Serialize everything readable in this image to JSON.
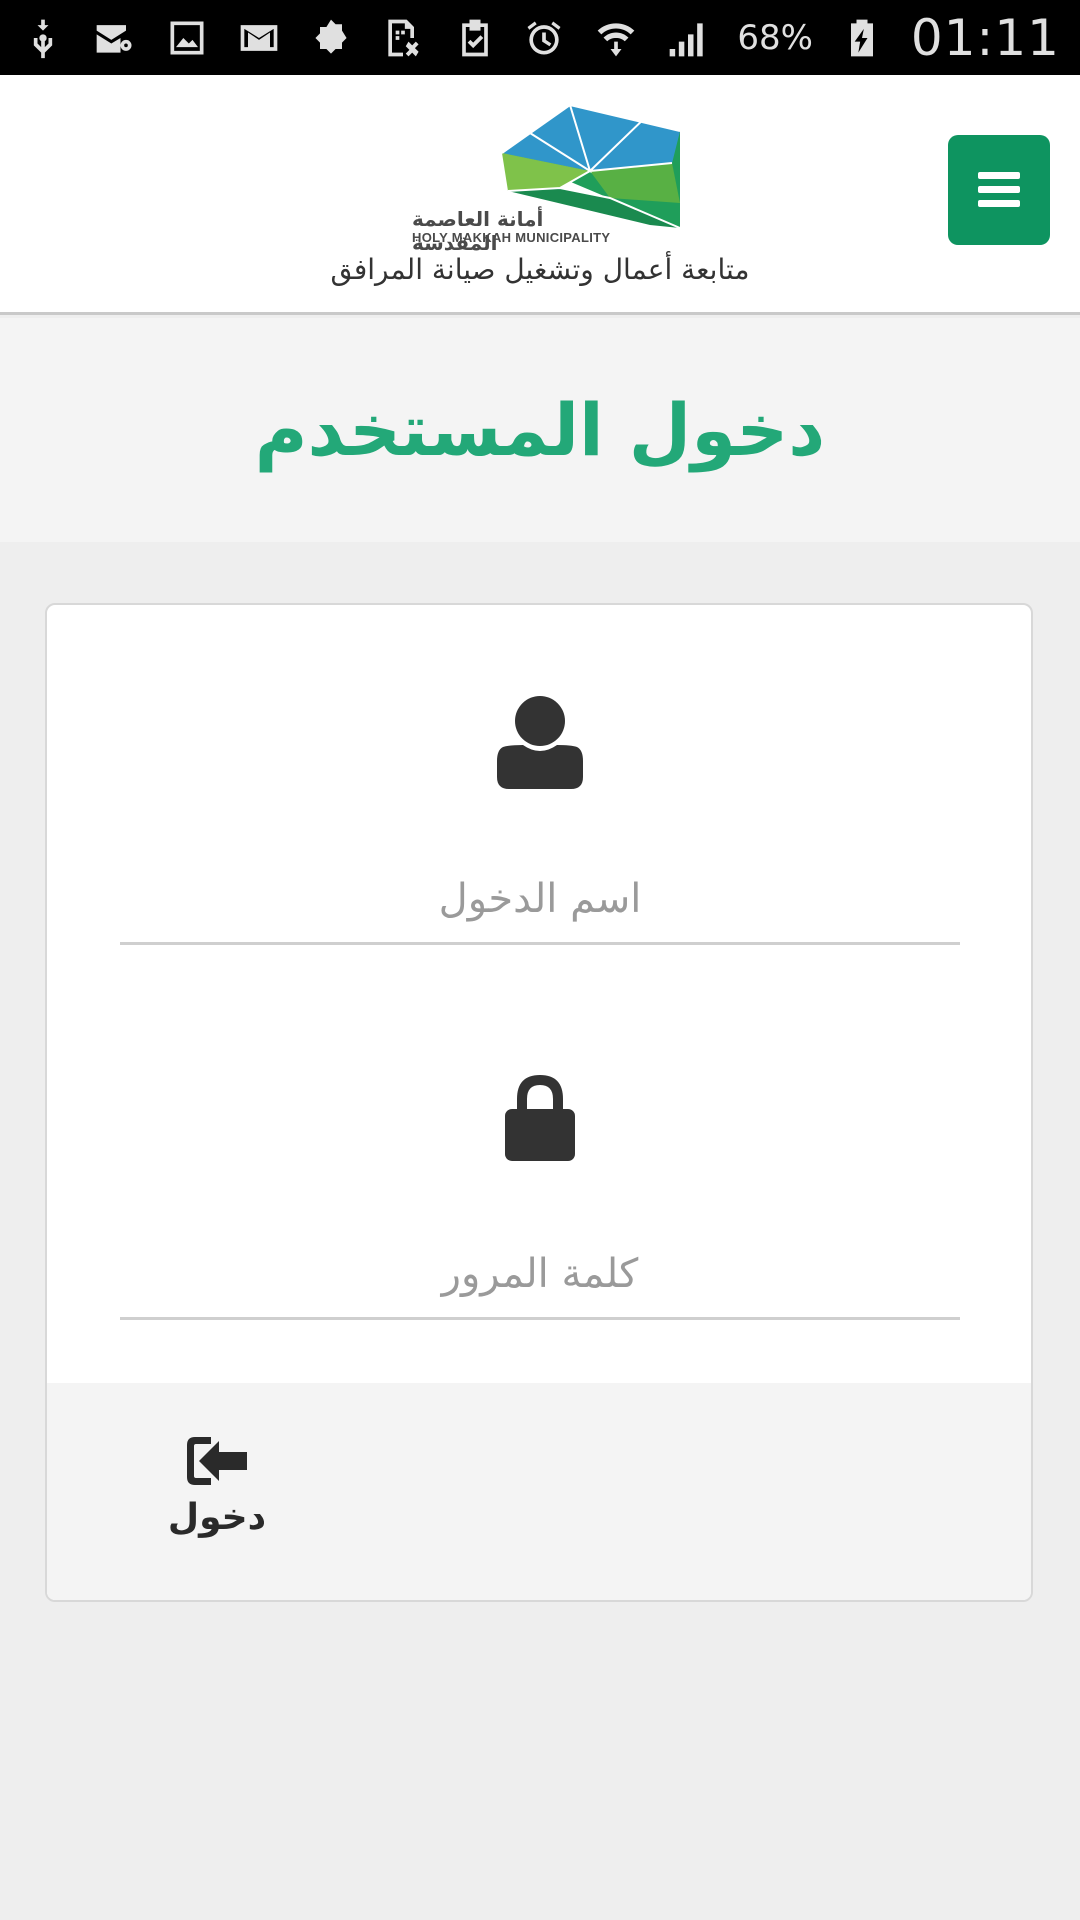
{
  "status_bar": {
    "icons": [
      "usb-icon",
      "mail-at-icon",
      "image-icon",
      "gmail-icon",
      "badge-icon",
      "sim-x-icon",
      "clipboard-check-icon",
      "alarm-icon",
      "wifi-icon",
      "signal-icon",
      "battery-charging-icon"
    ],
    "battery_percent": "68%",
    "time": "01:11"
  },
  "header": {
    "logo_ar": "أمانة العاصمة المقدسة",
    "logo_en": "HOLY MAKKAH MUNICIPALITY",
    "subtitle": "متابعة أعمال وتشغيل صيانة المرافق",
    "menu_icon": "hamburger-icon"
  },
  "page": {
    "title": "دخول المستخدم"
  },
  "form": {
    "username_placeholder": "اسم الدخول",
    "password_placeholder": "كلمة المرور",
    "login_label": "دخول"
  },
  "colors": {
    "accent": "#0e9460",
    "title": "#23a878"
  }
}
